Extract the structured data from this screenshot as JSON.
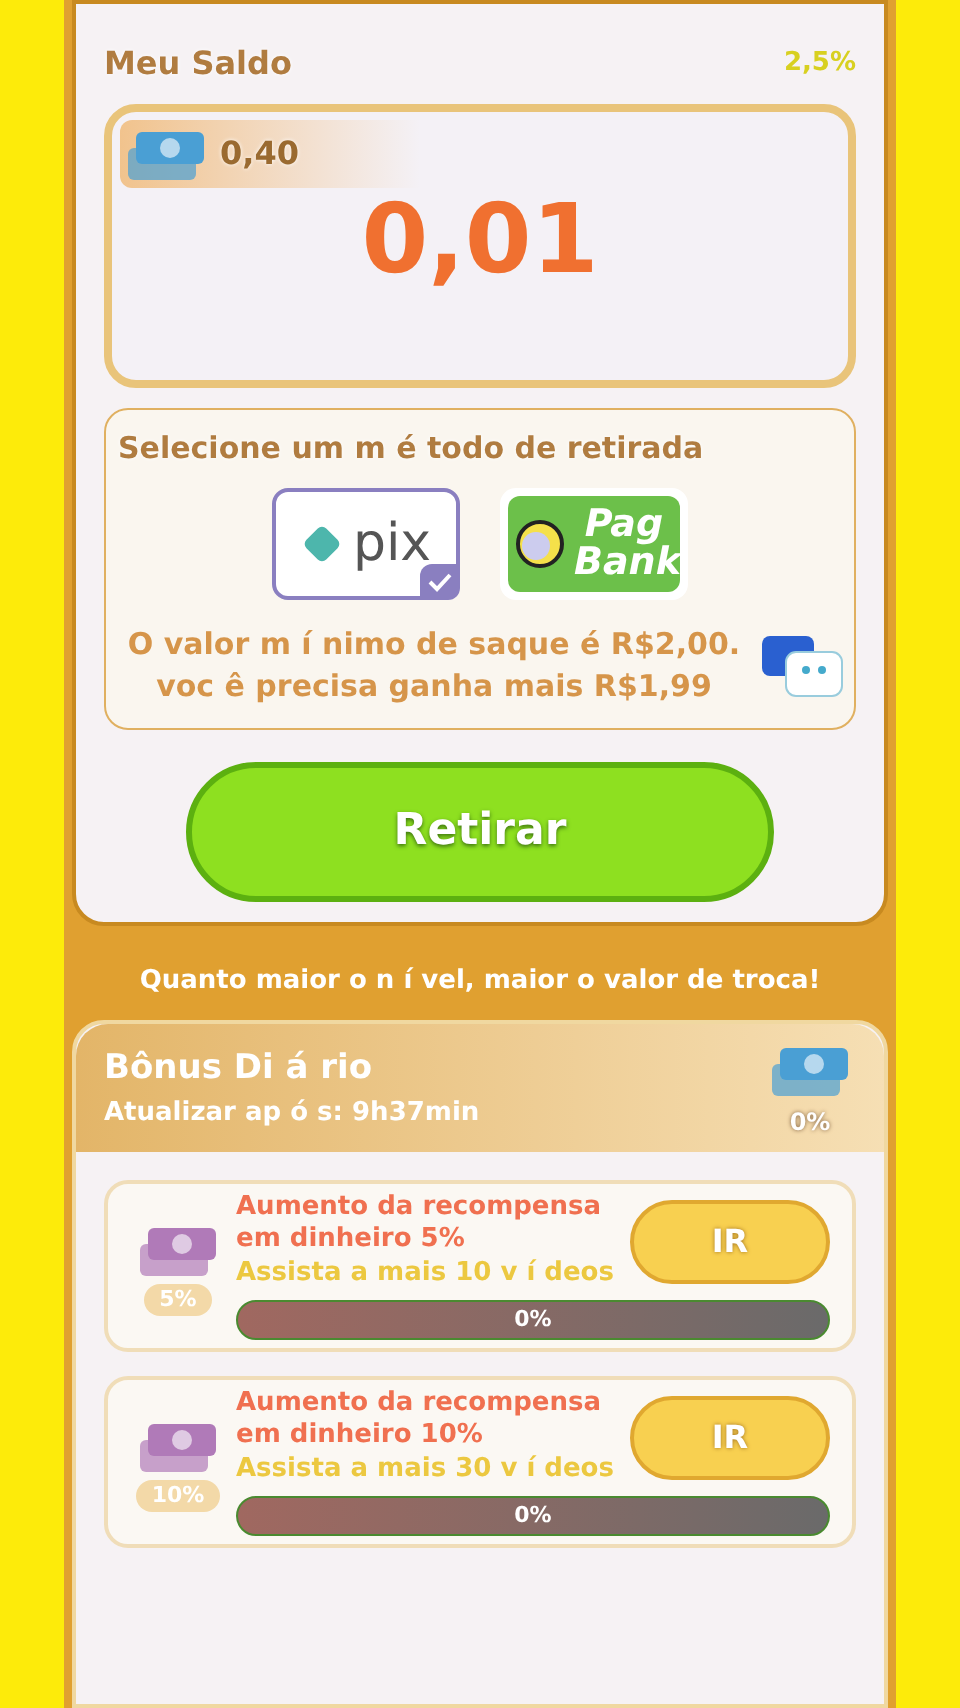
{
  "balance": {
    "title": "Meu Saldo",
    "rate": "2,5%",
    "coins": "0,40",
    "amount": "0,01"
  },
  "withdraw": {
    "title": "Selecione um m é todo de retirada",
    "methods": [
      {
        "kind": "pix",
        "label": "pix",
        "selected": true
      },
      {
        "kind": "pagbank",
        "label": "Pag Bank",
        "selected": false
      }
    ],
    "notice": "O valor m í nimo de saque é **R$2,00**. voc ê precisa ganha mais **R$1,99**",
    "button": "Retirar"
  },
  "tip": "Quanto maior o n í vel, maior o valor de troca!",
  "bonus": {
    "title": "Bônus Di á rio",
    "refresh": "Atualizar ap ó s: 9h37min",
    "percent": "0%",
    "tasks": [
      {
        "title": "Aumento da recompensa em dinheiro 5%",
        "badge": "5%",
        "subtitle": "Assista a mais 10 v í deos",
        "button": "IR",
        "level": 0,
        "progress": "0%"
      },
      {
        "title": "Aumento da recompensa em dinheiro 10%",
        "badge": "10%",
        "subtitle": "Assista a mais 30 v í deos",
        "button": "IR",
        "level": 0,
        "progress": "0%"
      }
    ]
  }
}
